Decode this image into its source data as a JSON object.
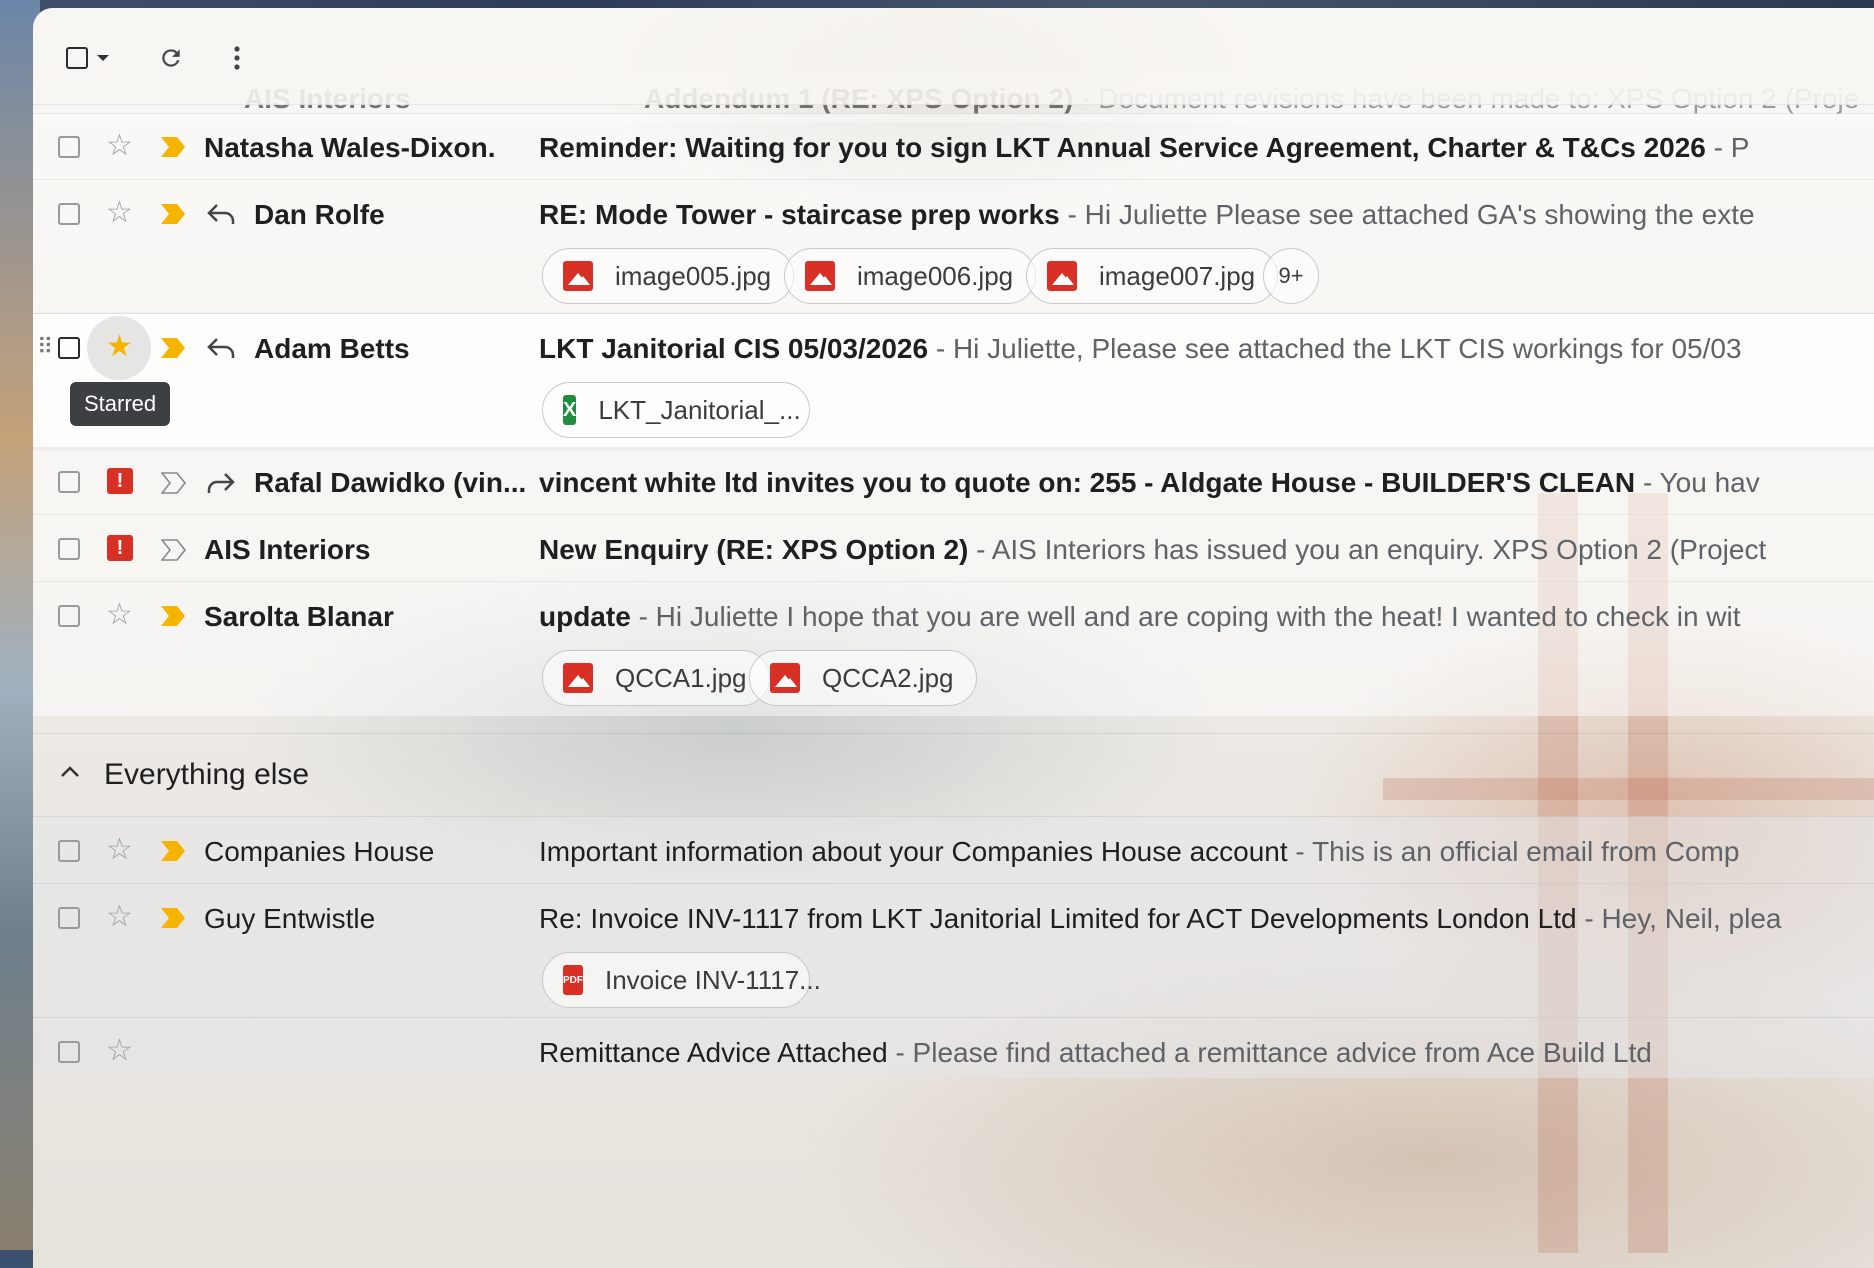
{
  "toolbar": {
    "select_icon": "checkbox-icon",
    "refresh_icon": "refresh-icon",
    "more_icon": "more-vert-icon"
  },
  "partial_top_row": {
    "sender": "AIS Interiors",
    "subject": "Addendum 1 (RE: XPS Option 2)",
    "snippet": "- Document revisions have been made to: XPS Option 2 (Proje"
  },
  "rows": [
    {
      "sender": "Natasha Wales-Dixon.",
      "subject": "Reminder: Waiting for you to sign LKT Annual Service Agreement, Charter & T&Cs 2026",
      "snippet": "- P"
    },
    {
      "sender": "Dan Rolfe",
      "subject": "RE: Mode Tower - staircase prep works",
      "snippet": "- Hi Juliette Please see attached GA's showing the exte",
      "attachments": [
        "image005.jpg",
        "image006.jpg",
        "image007.jpg"
      ],
      "more_attachments": "9+"
    },
    {
      "sender": "Adam Betts",
      "subject": "LKT Janitorial CIS 05/03/2026",
      "snippet": "- Hi Juliette, Please see attached the LKT CIS workings for 05/03",
      "attachments": [
        "LKT_Janitorial_..."
      ],
      "tooltip": "Starred"
    },
    {
      "sender": "Rafal Dawidko (vin...",
      "subject": "vincent white ltd invites you to quote on: 255 - Aldgate House - BUILDER'S CLEAN",
      "snippet": "- You hav"
    },
    {
      "sender": "AIS Interiors",
      "subject": "New Enquiry (RE: XPS Option 2)",
      "snippet": "- AIS Interiors has issued you an enquiry. XPS Option 2 (Project"
    },
    {
      "sender": "Sarolta Blanar",
      "subject": "update",
      "snippet": "- Hi Juliette I hope that you are well and are coping with the heat! I wanted to check in wit",
      "attachments": [
        "QCCA1.jpg",
        "QCCA2.jpg"
      ]
    }
  ],
  "section": {
    "title": "Everything else"
  },
  "else_rows": [
    {
      "sender": "Companies House",
      "subject": "Important information about your Companies House account",
      "snippet": "- This is an official email from Comp"
    },
    {
      "sender": "Guy Entwistle",
      "subject": "Re: Invoice INV-1117 from LKT Janitorial Limited for ACT Developments London Ltd",
      "snippet": "- Hey, Neil, plea",
      "attachments": [
        "Invoice INV-1117..."
      ]
    }
  ],
  "partial_bottom_row": {
    "sender": "",
    "subject": "Remittance Advice Attached",
    "snippet": "- Please find attached a remittance advice from Ace Build Ltd"
  },
  "colors": {
    "star": "#f4b400",
    "important_marker": "#f4b400",
    "urgent": "#d93025",
    "excel": "#1e8e3e"
  }
}
